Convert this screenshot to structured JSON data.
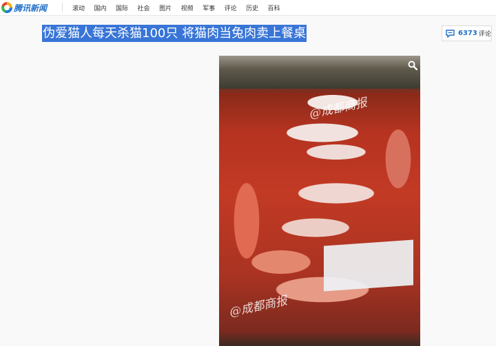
{
  "header": {
    "logo_text": "腾讯新闻",
    "nav": [
      "滚动",
      "国内",
      "国际",
      "社会",
      "图片",
      "视频",
      "军事",
      "评论",
      "历史",
      "百科"
    ]
  },
  "article": {
    "title": "伪爱猫人每天杀猫100只 将猫肉当兔肉卖上餐桌"
  },
  "comments": {
    "count": "6373",
    "label": "评论"
  },
  "photo": {
    "watermark_top": "@成都商报",
    "watermark_bottom": "@成都商报",
    "zoom_icon": "magnifier-icon"
  },
  "colors": {
    "accent": "#1f6fc9",
    "selection": "#3875d7"
  }
}
